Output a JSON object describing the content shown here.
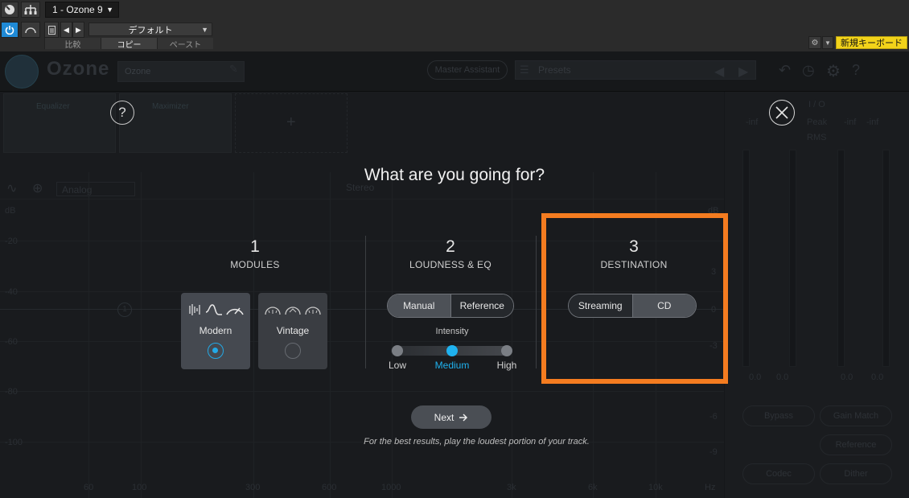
{
  "host": {
    "tab_title": "1 - Ozone 9",
    "preset_value": "デフォルト",
    "compare_label": "比較",
    "copy_label": "コピー",
    "paste_label": "ペースト",
    "new_keyboard_label": "新規キーボード"
  },
  "plugin": {
    "logo": "Ozone",
    "preset_name": "Ozone",
    "assistant_label": "Master Assistant",
    "presets_label": "Presets",
    "modules": [
      "Equalizer",
      "Maximizer"
    ],
    "eq_mode": "Analog",
    "stereo_label": "Stereo",
    "db_axis": [
      "dB",
      "-20",
      "-40",
      "-60",
      "-80",
      "-100"
    ],
    "freq_axis": [
      "60",
      "100",
      "300",
      "600",
      "1000",
      "3k",
      "6k",
      "10k",
      "Hz"
    ],
    "right_axis": [
      "dB",
      "3",
      "0",
      "-3",
      "-6",
      "-9"
    ],
    "meter_header": "I / O",
    "meter_peak": "Peak",
    "meter_rms": "RMS",
    "meter_inf": "-inf",
    "meter_zero": "0.0",
    "bypass_label": "Bypass",
    "gain_match_label": "Gain Match",
    "reference_label": "Reference",
    "codec_label": "Codec",
    "dither_label": "Dither"
  },
  "modal": {
    "title": "What are you going for?",
    "col1": {
      "num": "1",
      "label": "MODULES"
    },
    "col2": {
      "num": "2",
      "label": "LOUDNESS & EQ"
    },
    "col3": {
      "num": "3",
      "label": "DESTINATION"
    },
    "modules": [
      {
        "name": "Modern",
        "selected": true
      },
      {
        "name": "Vintage",
        "selected": false
      }
    ],
    "loudness_options": [
      "Manual",
      "Reference"
    ],
    "loudness_selected": "Manual",
    "intensity_label": "Intensity",
    "intensity_stops": [
      "Low",
      "Medium",
      "High"
    ],
    "intensity_selected": "Medium",
    "destination_options": [
      "Streaming",
      "CD"
    ],
    "destination_selected": "CD",
    "next_label": "Next",
    "hint": "For the best results, play the loudest portion of your track."
  },
  "colors": {
    "accent": "#1fb2ef",
    "highlight": "#f47c20",
    "yellow": "#f2d31a"
  }
}
